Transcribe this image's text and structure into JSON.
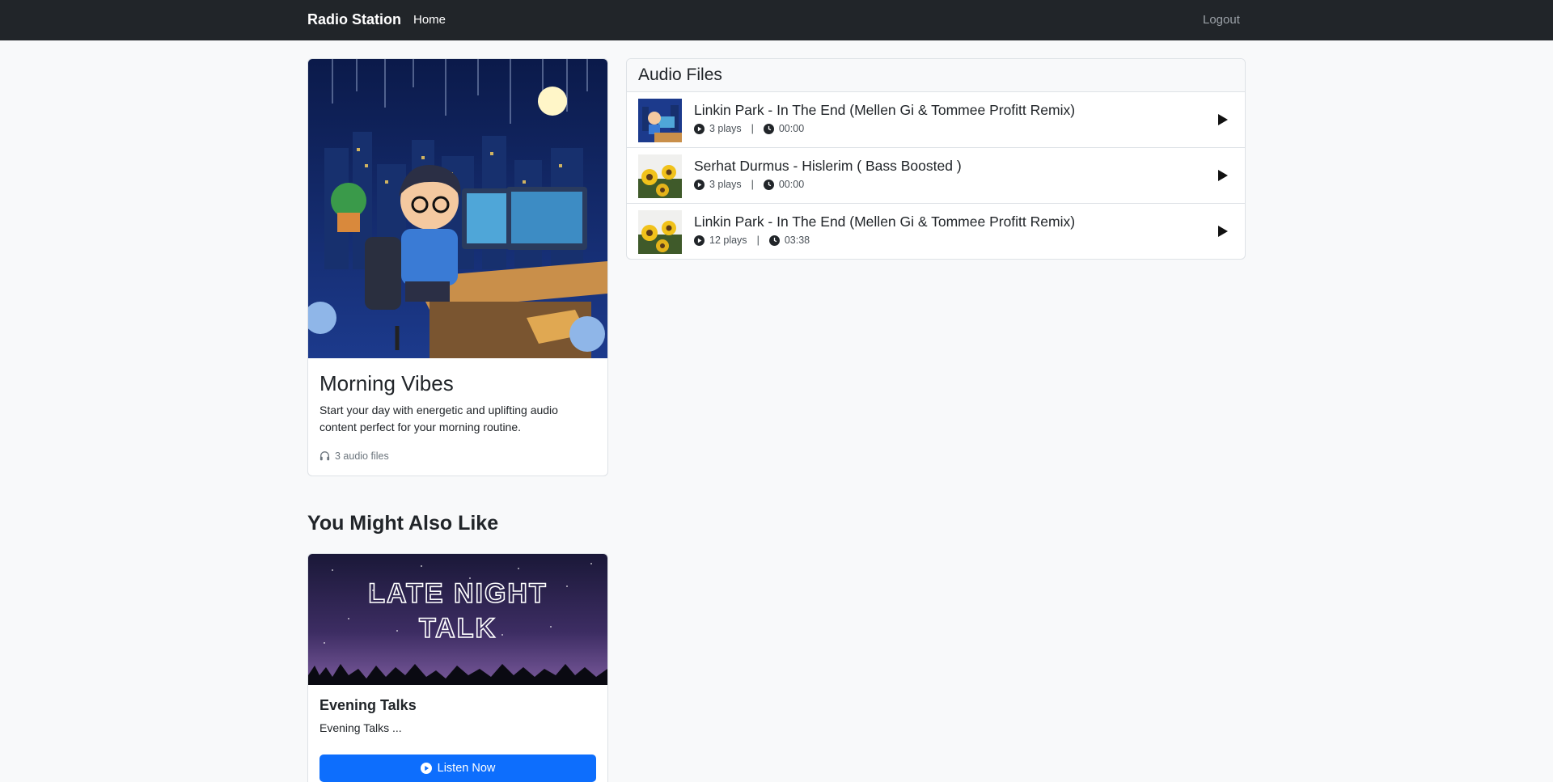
{
  "nav": {
    "brand": "Radio Station",
    "home": "Home",
    "logout": "Logout"
  },
  "station": {
    "title": "Morning Vibes",
    "description": "Start your day with energetic and uplifting audio content perfect for your morning routine.",
    "audio_count": "3 audio files",
    "image_icon": "night-city-coder-illustration"
  },
  "files": {
    "title": "Audio Files",
    "tracks": [
      {
        "title": "Linkin Park - In The End (Mellen Gi & Tommee Profitt Remix)",
        "plays": "3 plays",
        "duration": "00:00",
        "thumb": "city-coder-thumbnail"
      },
      {
        "title": "Serhat Durmus - Hislerim ( Bass Boosted )",
        "plays": "3 plays",
        "duration": "00:00",
        "thumb": "sunflower-thumbnail"
      },
      {
        "title": "Linkin Park - In The End (Mellen Gi & Tommee Profitt Remix)",
        "plays": "12 plays",
        "duration": "03:38",
        "thumb": "sunflower-thumbnail"
      }
    ]
  },
  "recommendations": {
    "title": "You Might Also Like",
    "items": [
      {
        "banner_line1": "LATE NIGHT",
        "banner_line2": "TALK",
        "title": "Evening Talks",
        "description": "Evening Talks ...",
        "button": "Listen Now"
      }
    ]
  },
  "colors": {
    "navbar": "#212529",
    "primary": "#0d6efd",
    "background": "#f8f9fa"
  }
}
